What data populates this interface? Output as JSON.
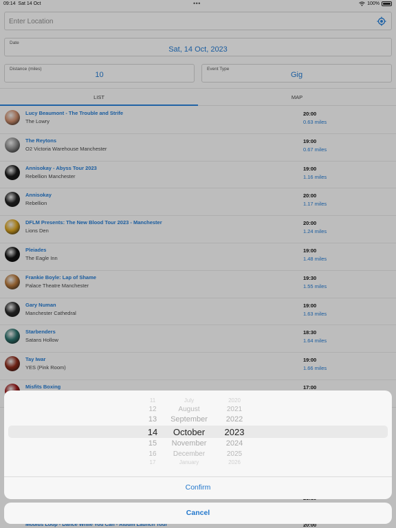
{
  "status_bar": {
    "time": "09:14",
    "date": "Sat 14 Oct",
    "battery": "100%"
  },
  "location": {
    "placeholder": "Enter Location"
  },
  "date_field": {
    "label": "Date",
    "value": "Sat, 14 Oct, 2023"
  },
  "distance_field": {
    "label": "Distance (miles)",
    "value": "10"
  },
  "event_type_field": {
    "label": "Event Type",
    "value": "Gig"
  },
  "tabs": {
    "list": "LIST",
    "map": "MAP"
  },
  "events": [
    {
      "title": "Lucy Beaumont - The Trouble and Strife",
      "venue": "The Lowry",
      "time": "20:00",
      "distance": "0.63 miles",
      "color": "#c98b6b"
    },
    {
      "title": "The Reytons",
      "venue": "O2 Victoria Warehouse Manchester",
      "time": "19:00",
      "distance": "0.67 miles",
      "color": "#8a8a8a"
    },
    {
      "title": "Annisokay - Abyss Tour 2023",
      "venue": "Rebellion Manchester",
      "time": "19:00",
      "distance": "1.16 miles",
      "color": "#1a1a1a"
    },
    {
      "title": "Annisokay",
      "venue": "Rebellion",
      "time": "20:00",
      "distance": "1.17 miles",
      "color": "#222222"
    },
    {
      "title": "DFLM Presents: The New Blood Tour 2023 - Manchester",
      "venue": "Lions Den",
      "time": "20:00",
      "distance": "1.24 miles",
      "color": "#d4a020"
    },
    {
      "title": "Pleiades",
      "venue": "The Eagle Inn",
      "time": "19:00",
      "distance": "1.48 miles",
      "color": "#111111"
    },
    {
      "title": "Frankie Boyle: Lap of Shame",
      "venue": "Palace Theatre Manchester",
      "time": "19:30",
      "distance": "1.55 miles",
      "color": "#b3763a"
    },
    {
      "title": "Gary Numan",
      "venue": "Manchester Cathedral",
      "time": "19:00",
      "distance": "1.63 miles",
      "color": "#2a2a2a"
    },
    {
      "title": "Starbenders",
      "venue": "Satans Hollow",
      "time": "18:30",
      "distance": "1.64 miles",
      "color": "#2b6f6a"
    },
    {
      "title": "Tay Iwar",
      "venue": "YES (Pink Room)",
      "time": "19:00",
      "distance": "1.66 miles",
      "color": "#8a2a1a"
    },
    {
      "title": "Misfits Boxing",
      "venue": "",
      "time": "17:00",
      "distance": "",
      "color": "#9a1a1a"
    }
  ],
  "date_picker": {
    "days": [
      "11",
      "12",
      "13",
      "14",
      "15",
      "16",
      "17"
    ],
    "months": [
      "July",
      "August",
      "September",
      "October",
      "November",
      "December",
      "January"
    ],
    "years": [
      "2020",
      "2021",
      "2022",
      "2023",
      "2024",
      "2025",
      "2026"
    ],
    "confirm_label": "Confirm",
    "cancel_label": "Cancel"
  },
  "partial_rows": [
    {
      "title": "",
      "time": "21:15"
    },
    {
      "title": "Mobius Loop - Dance While You Can - Album Launch Tour",
      "time": "20:00"
    }
  ]
}
